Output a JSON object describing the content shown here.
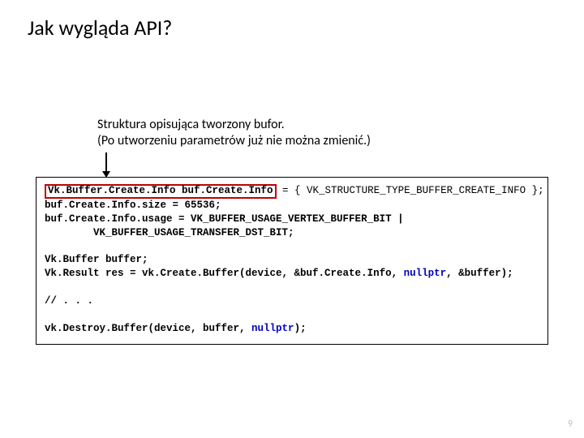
{
  "title": "Jak wygląda API?",
  "annotation_line1": "Struktura opisująca tworzony bufor.",
  "annotation_line2": "(Po utworzeniu parametrów już nie można zmienić.)",
  "code": {
    "line1_hl": "Vk.Buffer.Create.Info buf.Create.Info",
    "line1_rest": " = { VK_STRUCTURE_TYPE_BUFFER_CREATE_INFO };",
    "line2": "buf.Create.Info.size = 65536;",
    "line3": "buf.Create.Info.usage = VK_BUFFER_USAGE_VERTEX_BUFFER_BIT |",
    "line4_indent": "        VK_BUFFER_USAGE_TRANSFER_DST_BIT;",
    "line6": "Vk.Buffer buffer;",
    "line7a": "Vk.Result res = vk.Create.Buffer(device, &buf.Create.Info, ",
    "line7_null": "nullptr",
    "line7b": ", &buffer);",
    "line9": "// . . .",
    "line11a": "vk.Destroy.Buffer(device, buffer, ",
    "line11_null": "nullptr",
    "line11b": ");"
  },
  "page_number": "9"
}
